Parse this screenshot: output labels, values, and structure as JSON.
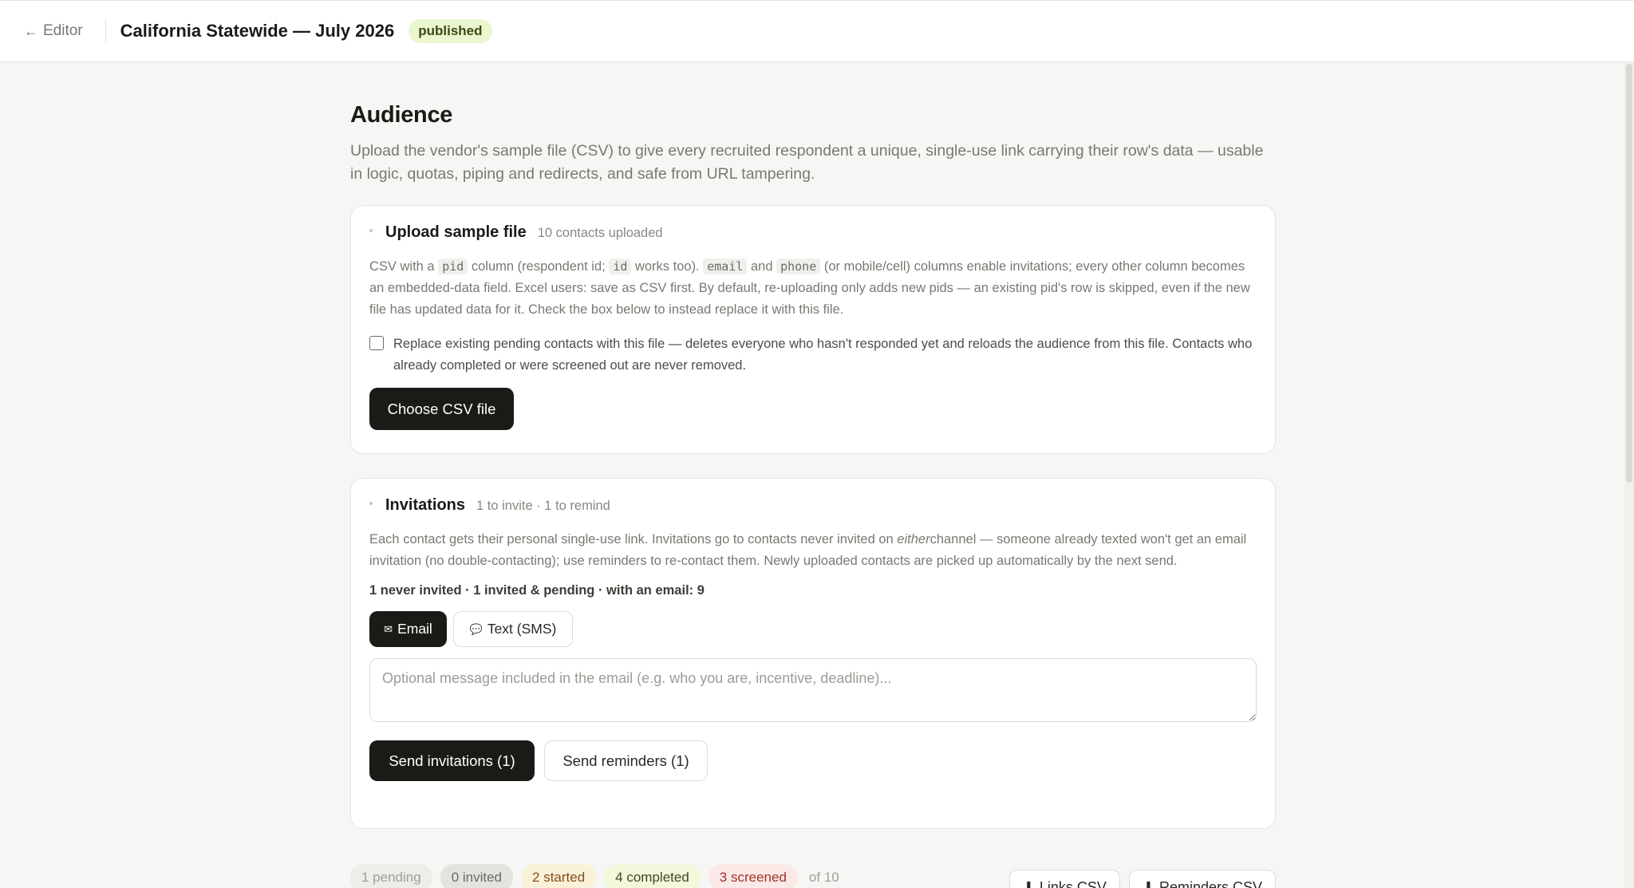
{
  "header": {
    "back_label": "Editor",
    "survey_title": "California Statewide — July 2026",
    "status": "published"
  },
  "page": {
    "title": "Audience",
    "description": "Upload the vendor's sample file (CSV) to give every recruited respondent a unique, single-use link carrying their row's data — usable in logic, quotas, piping and redirects, and safe from URL tampering."
  },
  "upload_card": {
    "title": "Upload sample file",
    "meta": "10 contacts uploaded",
    "body_1": "CSV with a ",
    "code_pid": "pid",
    "body_2": " column (respondent id; ",
    "code_id": "id",
    "body_3": " works too). ",
    "code_email": "email",
    "body_4": " and ",
    "code_phone": "phone",
    "body_5": " (or mobile/cell) columns enable invitations; every other column becomes an embedded-data field. Excel users: save as CSV first. By default, re-uploading only adds new pids — an existing pid's row is skipped, even if the new file has updated data for it. Check the box below to instead replace it with this file.",
    "replace_label": "Replace existing pending contacts with this file — deletes everyone who hasn't responded yet and reloads the audience from this file. Contacts who already completed or were screened out are never removed.",
    "replace_checked": false,
    "choose_button": "Choose CSV file"
  },
  "invitations_card": {
    "title": "Invitations",
    "meta": "1 to invite · 1 to remind",
    "body_1": "Each contact gets their personal single-use link. Invitations go to contacts never invited on ",
    "body_em": "either",
    "body_2": "channel — someone already texted won't get an email invitation (no double-contacting); use reminders to re-contact them. Newly uploaded contacts are picked up automatically by the next send.",
    "stats": "1 never invited · 1 invited & pending · with an email: 9",
    "channels": [
      {
        "label": "Email",
        "icon": "envelope-icon",
        "glyph": "✉",
        "active": true
      },
      {
        "label": "Text (SMS)",
        "icon": "speech-bubble-icon",
        "glyph": "💬",
        "active": false
      }
    ],
    "message_placeholder": "Optional message included in the email (e.g. who you are, incentive, deadline)...",
    "message_value": "",
    "send_button": "Send invitations (1)",
    "remind_button": "Send reminders (1)"
  },
  "status_summary": {
    "chips": [
      {
        "label": "1 pending"
      },
      {
        "label": "0 invited"
      },
      {
        "label": "2 started"
      },
      {
        "label": "4 completed"
      },
      {
        "label": "3 screened"
      }
    ],
    "total": "of 10",
    "links_csv": "Links CSV",
    "reminders_csv": "Reminders CSV",
    "download_glyph": "⬇"
  },
  "colors": {
    "accent_dark": "#1c1a17",
    "published_bg": "#e9f6cf",
    "started": "#8a4b1a",
    "completed": "#3b4a1f",
    "screened": "#a1322a"
  }
}
